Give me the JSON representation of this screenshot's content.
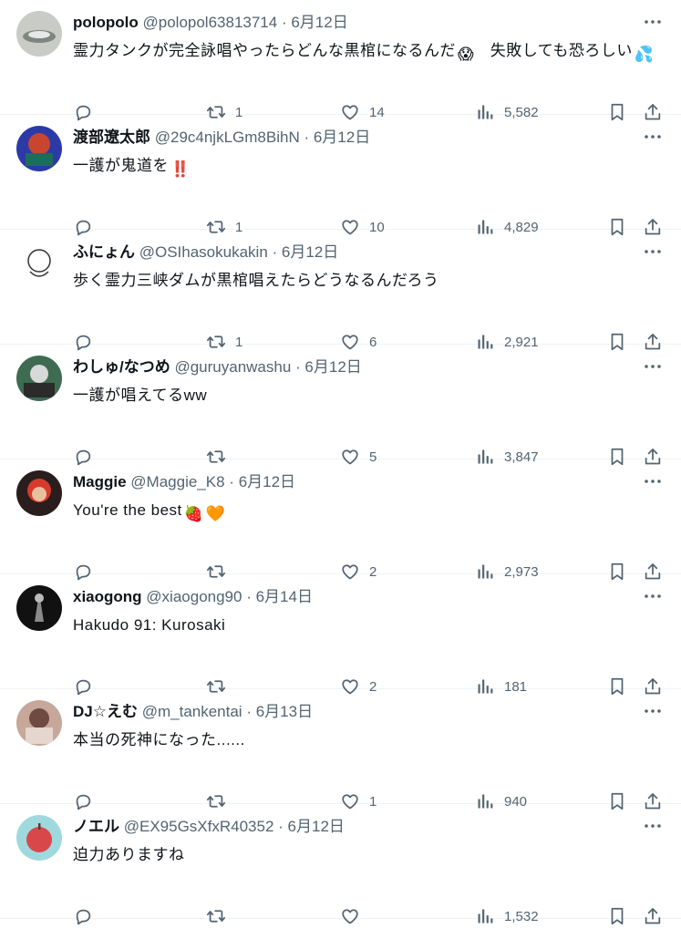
{
  "replies": [
    {
      "id": "r1",
      "name": "polopolo",
      "handle": "@polopol63813714",
      "sep": "·",
      "date": "6月12日",
      "text": "霊力タンクが完全詠唱やったらどんな黒棺になるんだ",
      "emoji1": "😱",
      "text2": "失敗しても恐ろしい",
      "emoji2": "💦",
      "replies": "",
      "retweets": "1",
      "likes": "14",
      "views": "5,582",
      "avatar": {
        "bg": "#c9ccc6",
        "fg": "#7f8580"
      }
    },
    {
      "id": "r2",
      "name": "渡部遼太郎",
      "handle": "@29c4njkLGm8BihN",
      "sep": "·",
      "date": "6月12日",
      "text": "一護が鬼道を",
      "emoji1": "‼️",
      "replies": "",
      "retweets": "1",
      "likes": "10",
      "views": "4,829",
      "avatar": {
        "bg": "#2c3aa8",
        "fg": "#c8462f"
      }
    },
    {
      "id": "r3",
      "name": "ふにょん",
      "handle": "@OSIhasokukakin",
      "sep": "·",
      "date": "6月12日",
      "text": "歩く霊力三峡ダムが黒棺唱えたらどうなるんだろう",
      "replies": "",
      "retweets": "1",
      "likes": "6",
      "views": "2,921",
      "avatar": {
        "bg": "#ffffff",
        "fg": "#333333"
      }
    },
    {
      "id": "r4",
      "name": "わしゅ/なつめ",
      "handle": "@guruyanwashu",
      "sep": "·",
      "date": "6月12日",
      "text": "一護が唱えてるww",
      "replies": "",
      "retweets": "",
      "likes": "5",
      "views": "3,847",
      "avatar": {
        "bg": "#3e6b52",
        "fg": "#d9d9d9"
      }
    },
    {
      "id": "r5",
      "name": "Maggie",
      "handle": "@Maggie_K8",
      "sep": "·",
      "date": "6月12日",
      "text": "You're the best",
      "emoji1": "🍓",
      "emoji2": "🧡",
      "replies": "",
      "retweets": "",
      "likes": "2",
      "views": "2,973",
      "avatar": {
        "bg": "#2a1d1d",
        "fg": "#d83a2b"
      }
    },
    {
      "id": "r6",
      "name": "xiaogong",
      "handle": "@xiaogong90",
      "sep": "·",
      "date": "6月14日",
      "text": "Hakudo 91: Kurosaki",
      "replies": "",
      "retweets": "",
      "likes": "2",
      "views": "181",
      "avatar": {
        "bg": "#111111",
        "fg": "#8a8a8a"
      }
    },
    {
      "id": "r7",
      "name": "DJ☆えむ",
      "handle": "@m_tankentai",
      "sep": "·",
      "date": "6月13日",
      "text": "本当の死神になった......",
      "replies": "",
      "retweets": "",
      "likes": "1",
      "views": "940",
      "avatar": {
        "bg": "#c7a79a",
        "fg": "#6e4a40"
      }
    },
    {
      "id": "r8",
      "name": "ノエル",
      "handle": "@EX95GsXfxR40352",
      "sep": "·",
      "date": "6月12日",
      "text": "迫力ありますね",
      "replies": "",
      "retweets": "",
      "likes": "",
      "views": "1,532",
      "avatar": {
        "bg": "#9fd9de",
        "fg": "#d8484b"
      }
    }
  ],
  "icons": {
    "more": "more-dots-icon",
    "reply": "reply-bubble-icon",
    "retweet": "retweet-icon",
    "like": "heart-icon",
    "views": "views-bar-icon",
    "bookmark": "bookmark-icon",
    "share": "share-icon"
  },
  "colors": {
    "text": "#0f1419",
    "muted": "#536471",
    "divider": "#eff3f4"
  }
}
